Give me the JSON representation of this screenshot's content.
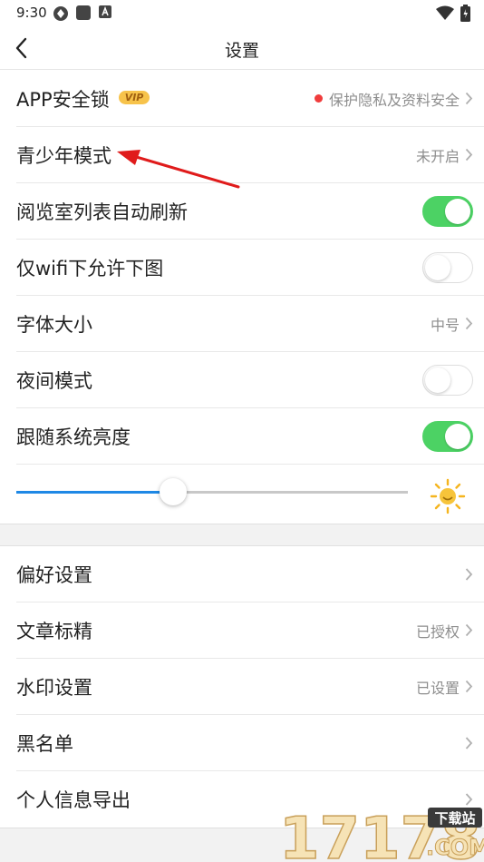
{
  "status_bar": {
    "time": "9:30"
  },
  "nav": {
    "title": "设置"
  },
  "rows": [
    {
      "label": "APP安全锁",
      "badge": "VIP",
      "value": "保护隐私及资料安全"
    },
    {
      "label": "青少年模式",
      "value": "未开启"
    },
    {
      "label": "阅览室列表自动刷新",
      "toggle": true
    },
    {
      "label": "仅wifi下允许下图",
      "toggle": false
    },
    {
      "label": "字体大小",
      "value": "中号"
    },
    {
      "label": "夜间模式",
      "toggle": false
    },
    {
      "label": "跟随系统亮度",
      "toggle": true
    }
  ],
  "brightness": {
    "level_percent": 40
  },
  "rows2": [
    {
      "label": "偏好设置",
      "value": ""
    },
    {
      "label": "文章标精",
      "value": "已授权"
    },
    {
      "label": "水印设置",
      "value": "已设置"
    },
    {
      "label": "黑名单",
      "value": ""
    },
    {
      "label": "个人信息导出",
      "value": ""
    }
  ],
  "watermark": {
    "number": "17178",
    "text": "下载站",
    "domain": ".COM"
  },
  "colors": {
    "toggle_on": "#4cd264",
    "slider_fill": "#1e88e5",
    "dot": "#f03c3c",
    "arrow": "#e01b1b"
  }
}
